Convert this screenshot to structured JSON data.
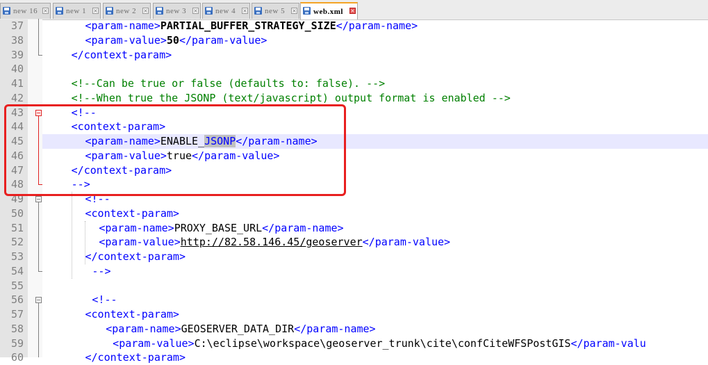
{
  "tabs": [
    {
      "label": "new 16",
      "active": false
    },
    {
      "label": "new 1",
      "active": false
    },
    {
      "label": "new 2",
      "active": false
    },
    {
      "label": "new 3",
      "active": false
    },
    {
      "label": "new 4",
      "active": false
    },
    {
      "label": "new 5",
      "active": false
    },
    {
      "label": "web.xml",
      "active": true
    }
  ],
  "close_glyph": "×",
  "current_line": "45",
  "lines": [
    {
      "num": "37",
      "segs": [
        [
          "tag",
          "<param-name>"
        ],
        [
          "bold",
          "PARTIAL_BUFFER_STRATEGY_SIZE"
        ],
        [
          "tag",
          "</param-name>"
        ]
      ]
    },
    {
      "num": "38",
      "segs": [
        [
          "tag",
          "<param-value>"
        ],
        [
          "bold",
          "50"
        ],
        [
          "tag",
          "</param-value>"
        ]
      ]
    },
    {
      "num": "39",
      "segs": [
        [
          "tag",
          "</context-param>"
        ]
      ]
    },
    {
      "num": "40",
      "segs": []
    },
    {
      "num": "41",
      "segs": [
        [
          "com",
          "<!--Can be true or false (defaults to: false). -->"
        ]
      ]
    },
    {
      "num": "42",
      "segs": [
        [
          "com",
          "<!--When true the JSONP (text/javascript) output format is enabled -->"
        ]
      ]
    },
    {
      "num": "43",
      "segs": [
        [
          "tag",
          "<!--"
        ]
      ]
    },
    {
      "num": "44",
      "segs": [
        [
          "tag",
          "<context-param>"
        ]
      ]
    },
    {
      "num": "45",
      "segs": [
        [
          "tag",
          "<param-name>"
        ],
        [
          "txt",
          "ENABLE_"
        ],
        [
          "hl",
          "JSONP"
        ],
        [
          "tag",
          "</param-name>"
        ]
      ]
    },
    {
      "num": "46",
      "segs": [
        [
          "tag",
          "<param-value>"
        ],
        [
          "txt",
          "true"
        ],
        [
          "tag",
          "</param-value>"
        ]
      ]
    },
    {
      "num": "47",
      "segs": [
        [
          "tag",
          "</context-param>"
        ]
      ]
    },
    {
      "num": "48",
      "segs": [
        [
          "tag",
          "-->"
        ]
      ]
    },
    {
      "num": "49",
      "segs": [
        [
          "tag",
          "<!--"
        ]
      ]
    },
    {
      "num": "50",
      "segs": [
        [
          "tag",
          "<context-param>"
        ]
      ]
    },
    {
      "num": "51",
      "segs": [
        [
          "tag",
          "<param-name>"
        ],
        [
          "txt",
          "PROXY_BASE_URL"
        ],
        [
          "tag",
          "</param-name>"
        ]
      ]
    },
    {
      "num": "52",
      "segs": [
        [
          "tag",
          "<param-value>"
        ],
        [
          "link",
          "http://82.58.146.45/geoserver"
        ],
        [
          "tag",
          "</param-value>"
        ]
      ]
    },
    {
      "num": "53",
      "segs": [
        [
          "tag",
          "</context-param>"
        ]
      ]
    },
    {
      "num": "54",
      "segs": [
        [
          "tag",
          "-->"
        ]
      ]
    },
    {
      "num": "55",
      "segs": []
    },
    {
      "num": "56",
      "segs": [
        [
          "tag",
          "<!--"
        ]
      ]
    },
    {
      "num": "57",
      "segs": [
        [
          "tag",
          "<context-param>"
        ]
      ]
    },
    {
      "num": "58",
      "segs": [
        [
          "tag",
          "<param-name>"
        ],
        [
          "txt",
          "GEOSERVER_DATA_DIR"
        ],
        [
          "tag",
          "</param-name>"
        ]
      ]
    },
    {
      "num": "59",
      "segs": [
        [
          "tag",
          "<param-value>"
        ],
        [
          "txt",
          "C:\\eclipse\\workspace\\geoserver_trunk\\cite\\confCiteWFSPostGIS"
        ],
        [
          "tag",
          "</param-valu"
        ]
      ]
    },
    {
      "num": "60",
      "segs": [
        [
          "tag",
          "</context-param>"
        ]
      ]
    }
  ]
}
